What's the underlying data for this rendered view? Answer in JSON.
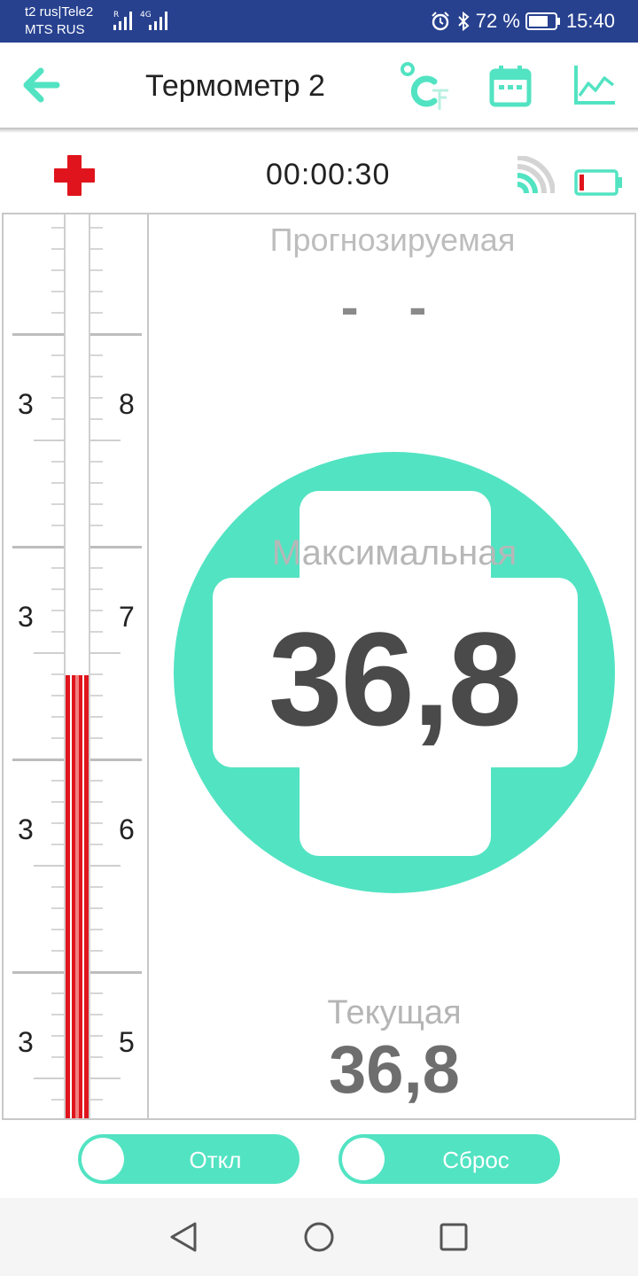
{
  "status_bar": {
    "carrier1": "t2 rus|Tele2",
    "carrier2": "MTS RUS",
    "roaming": "R",
    "network": "4G",
    "battery_percent": "72 %",
    "time": "15:40"
  },
  "app_bar": {
    "title": "Термометр 2"
  },
  "info": {
    "timer": "00:00:30",
    "battery_level": 0.12
  },
  "thermometer": {
    "left_labels": [
      "3",
      "3",
      "3",
      "3"
    ],
    "right_labels": [
      "8",
      "7",
      "6",
      "5"
    ],
    "mercury_level": 0.49
  },
  "readings": {
    "forecast_label": "Прогнозируемая",
    "forecast_value": "- -",
    "max_label": "Максимальная",
    "max_value": "36,8",
    "current_label": "Текущая",
    "current_value": "36,8"
  },
  "controls": {
    "off_label": "Откл",
    "reset_label": "Сброс"
  },
  "colors": {
    "accent": "#52e3c2",
    "status_bar": "#27418f",
    "mercury": "#e0141c"
  }
}
